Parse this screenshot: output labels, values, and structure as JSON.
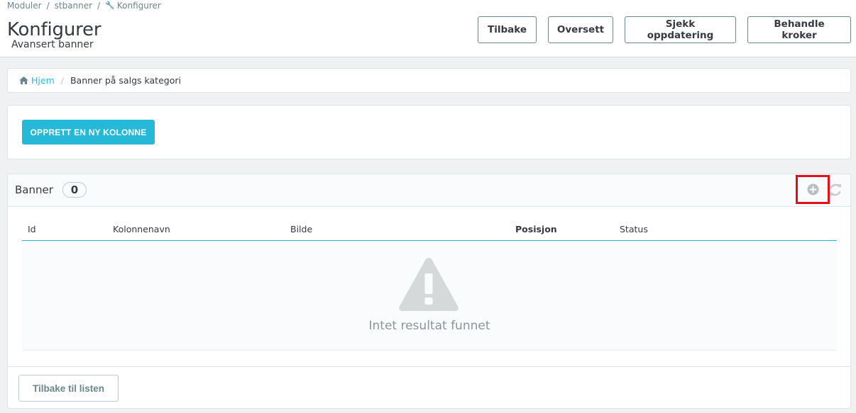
{
  "header": {
    "breadcrumbs": [
      "Moduler",
      "stbanner",
      "Konfigurer"
    ],
    "title": "Konfigurer",
    "subtitle": "Avansert banner",
    "toolbar": {
      "back": "Tilbake",
      "translate": "Oversett",
      "check_update": "Sjekk oppdatering",
      "manage_hooks": "Behandle kroker"
    }
  },
  "breadcrumb": {
    "home": "Hjem",
    "current": "Banner på salgs kategori"
  },
  "actions": {
    "create_column": "OPPRETT EN NY KOLONNE"
  },
  "list": {
    "title": "Banner",
    "count": "0",
    "columns": {
      "id": "Id",
      "name": "Kolonnenavn",
      "image": "Bilde",
      "position": "Posisjon",
      "status": "Status"
    },
    "empty_text": "Intet resultat funnet",
    "back_to_list": "Tilbake til listen"
  },
  "colors": {
    "accent": "#25b9d7",
    "highlight": "#e2101a"
  }
}
